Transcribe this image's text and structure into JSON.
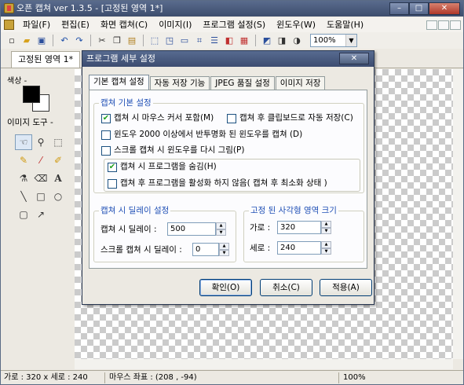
{
  "window": {
    "title": "오픈 캡쳐 ver 1.3.5 - [고정된 영역 1*]",
    "controls": {
      "minimize": "–",
      "maximize": "□",
      "close": "✕"
    }
  },
  "menubar": [
    "파일(F)",
    "편집(E)",
    "화면 캡쳐(C)",
    "이미지(I)",
    "프로그램 설정(S)",
    "윈도우(W)",
    "도움말(H)"
  ],
  "toolbar": {
    "zoom_value": "100%"
  },
  "document_tab": "고정된 영역 1*",
  "left_panel": {
    "color_label": "색상 -",
    "tools_label": "이미지 도구 -",
    "primary_color": "#000000",
    "secondary_color": "#ffffff"
  },
  "tool_icons": [
    "hand-icon",
    "magnifier-icon",
    "marquee-select-icon",
    "pencil-icon",
    "eyedropper-icon",
    "dropper-color-icon",
    "paint-bucket-icon",
    "eraser-icon",
    "text-icon",
    "line-icon",
    "rectangle-icon",
    "ellipse-icon",
    "rounded-rect-icon",
    "arrow-icon"
  ],
  "text_tool_glyph": "A",
  "statusbar": {
    "size": "가로 : 320 x 세로 : 240",
    "mouse": "마우스 좌표 : (208 , -94)",
    "zoom": "100%"
  },
  "dialog": {
    "title": "프로그램 세부 설정",
    "close_label": "✕",
    "tabs": [
      "기본 캡쳐 설정",
      "자동 저장 기능",
      "JPEG 품질 설정",
      "이미지 저장"
    ],
    "group_basic": {
      "title": "캡쳐 기본 설정",
      "options": [
        {
          "label": "캡쳐 시 마우스 커서 포함(M)",
          "checked": true
        },
        {
          "label": "캡쳐 후 클립보드로 자동 저장(C)",
          "checked": false
        },
        {
          "label": "윈도우 2000 이상에서 반투명화 된 윈도우를 캡쳐 (D)",
          "checked": false
        },
        {
          "label": "스크롤 캡쳐 시 윈도우를 다시 그림(P)",
          "checked": false
        },
        {
          "label": "캡쳐 시 프로그램을 숨김(H)",
          "checked": true
        },
        {
          "label": "캡쳐 후 프로그램을 활성화 하지 않음( 캡쳐 후 최소화 상태 )",
          "checked": false
        }
      ]
    },
    "group_delay": {
      "title": "캡쳐 시 딜레이 설정",
      "capture_delay_label": "캡쳐 시 딜레이 :",
      "capture_delay_value": "500",
      "scroll_delay_label": "스크롤 캡쳐 시 딜레이 :",
      "scroll_delay_value": "0"
    },
    "group_size": {
      "title": "고정 된 사각형 영역 크기",
      "width_label": "가로 :",
      "width_value": "320",
      "height_label": "세로 :",
      "height_value": "240"
    },
    "buttons": {
      "ok": "확인(O)",
      "cancel": "취소(C)",
      "apply": "적용(A)"
    }
  }
}
